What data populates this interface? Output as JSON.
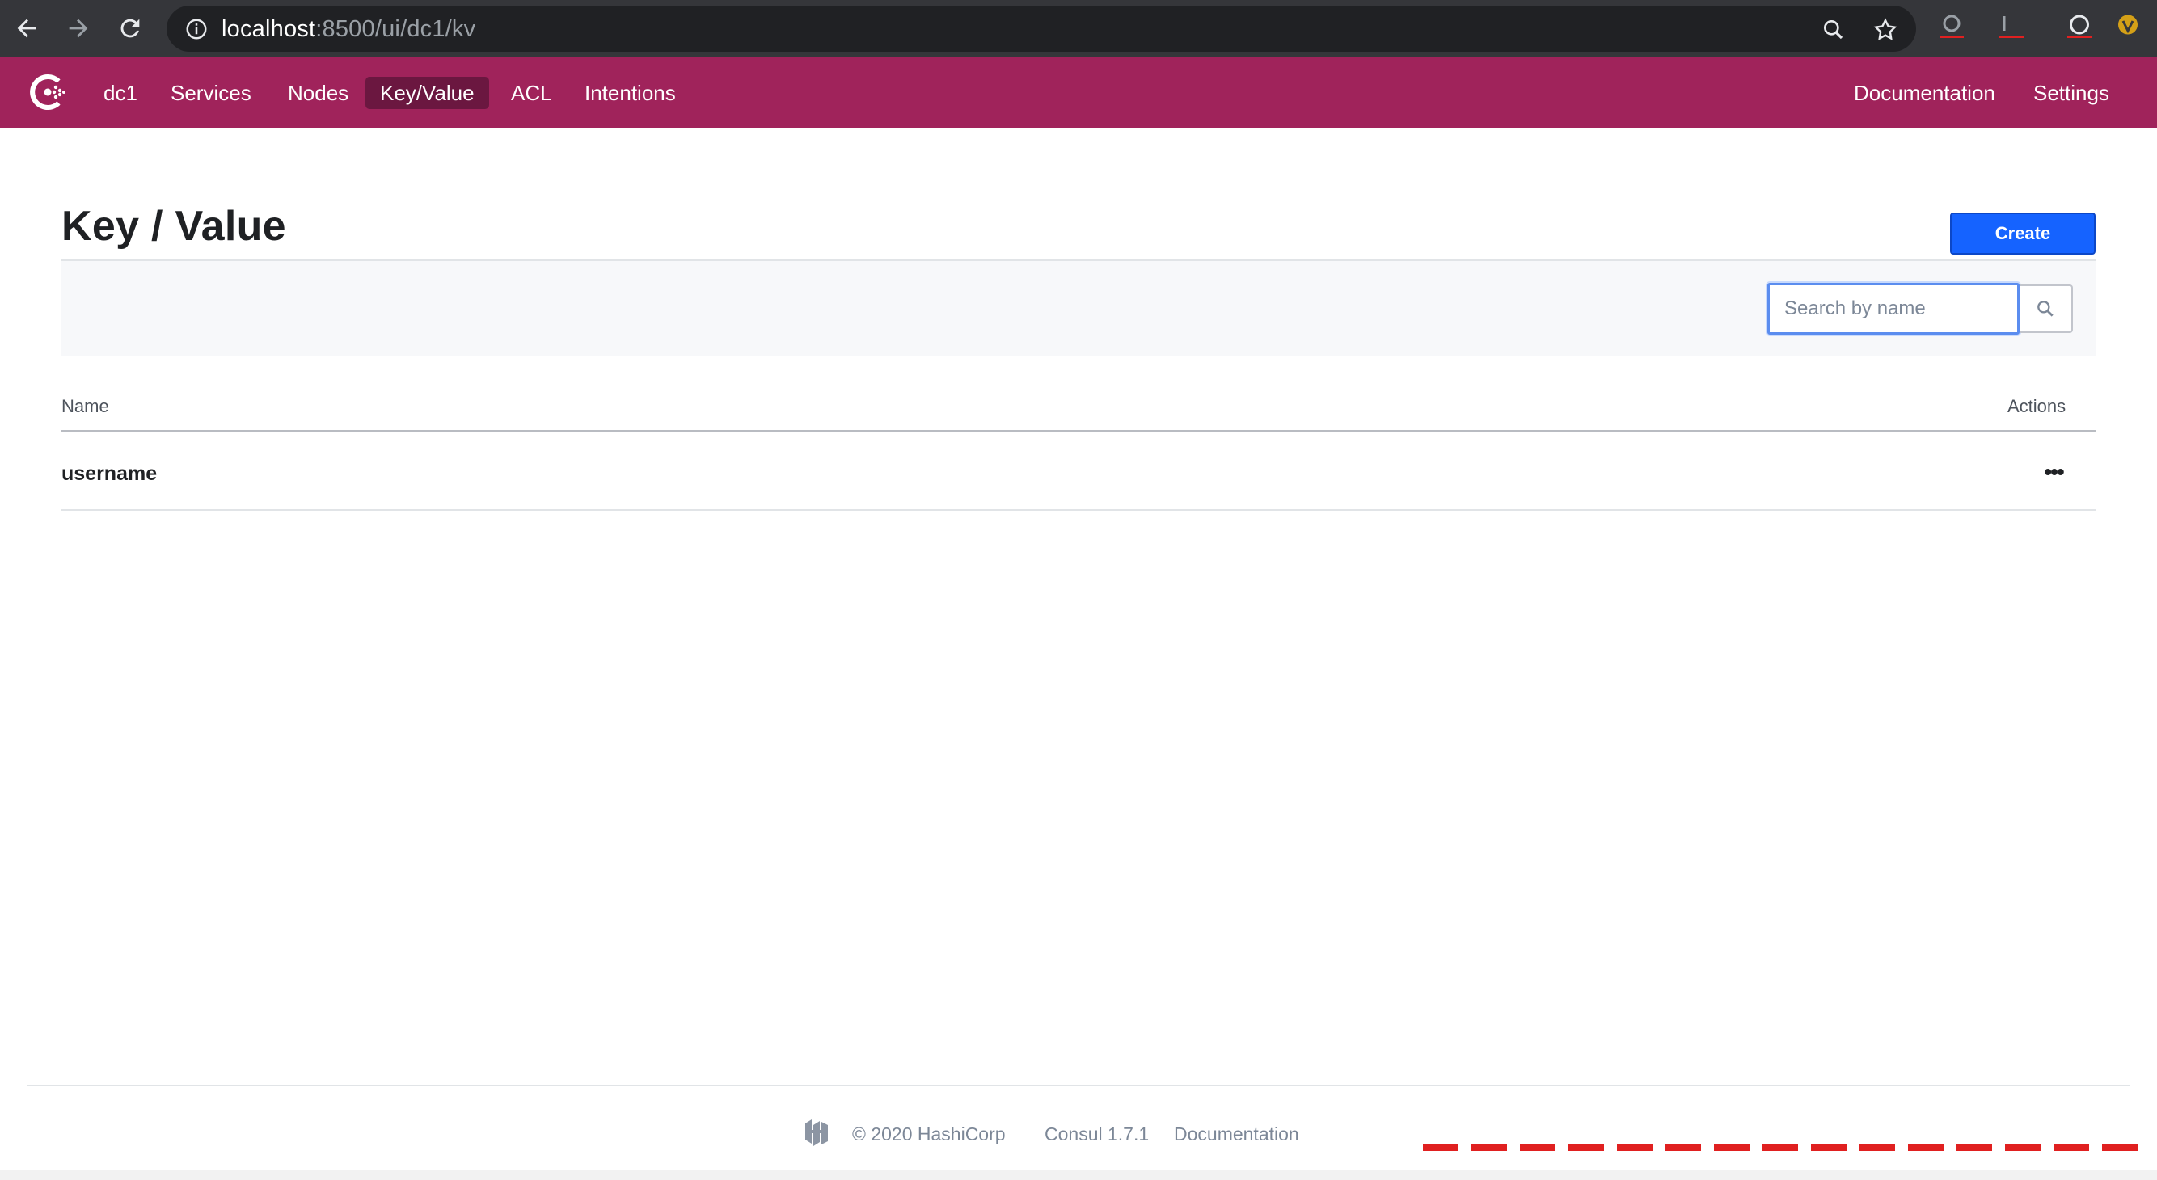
{
  "browser": {
    "url_host": "localhost",
    "url_path": ":8500/ui/dc1/kv"
  },
  "header": {
    "datacenter": "dc1",
    "nav": [
      "Services",
      "Nodes",
      "Key/Value",
      "ACL",
      "Intentions"
    ],
    "active_nav": "Key/Value",
    "right_nav": [
      "Documentation",
      "Settings"
    ]
  },
  "main": {
    "title": "Key / Value",
    "create_label": "Create",
    "search_placeholder": "Search by name",
    "search_value": "",
    "columns": [
      "Name",
      "Actions"
    ],
    "rows": [
      {
        "name": "username",
        "actions": "•••"
      }
    ]
  },
  "footer": {
    "copyright": "© 2020 HashiCorp",
    "version": "Consul 1.7.1",
    "docs": "Documentation"
  },
  "colors": {
    "header_bg": "#a0235b",
    "active_nav_bg": "#6b1740",
    "create_bg": "#1563ff",
    "browser_bg": "#35363a"
  }
}
